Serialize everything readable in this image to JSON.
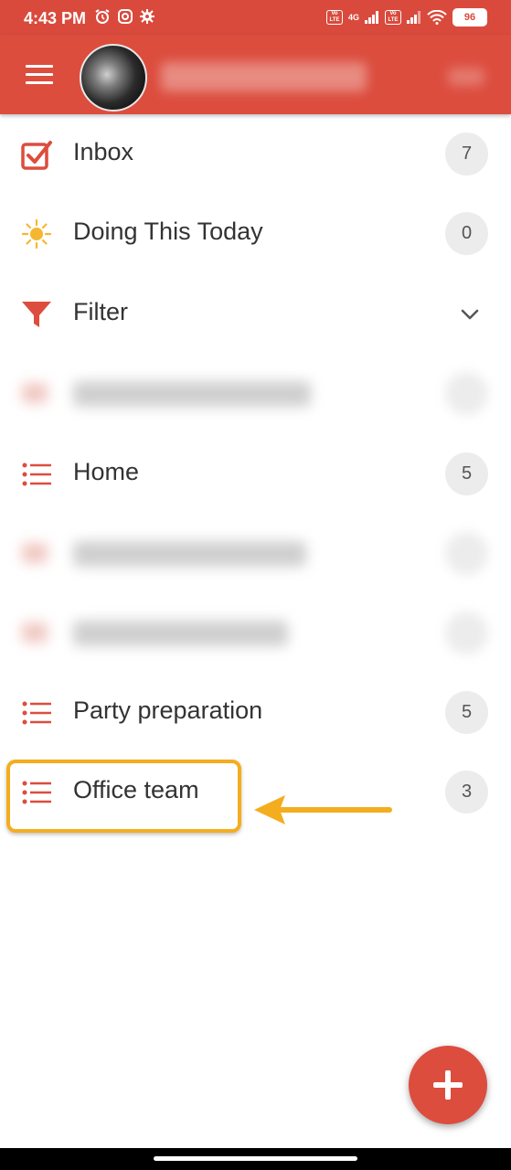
{
  "status_bar": {
    "time": "4:43 PM",
    "battery": "96",
    "network": "4G",
    "volte": "Vo LTE"
  },
  "app_bar": {
    "menu_icon": "hamburger-icon",
    "avatar": "avatar"
  },
  "nav_items": [
    {
      "label": "Inbox",
      "count": "7",
      "icon": "checkbox-icon"
    },
    {
      "label": "Doing This Today",
      "count": "0",
      "icon": "sun-icon"
    },
    {
      "label": "Filter",
      "icon": "filter-icon",
      "trailing": "chevron-down-icon"
    },
    {
      "label": "Home",
      "count": "5",
      "icon": "list-icon"
    },
    {
      "label": "Party preparation",
      "count": "5",
      "icon": "list-icon"
    },
    {
      "label": "Office team",
      "count": "3",
      "icon": "list-icon"
    }
  ],
  "fab": {
    "icon": "plus-icon"
  },
  "colors": {
    "primary": "#dc4d3e",
    "highlight": "#f4ad1f",
    "badge_bg": "#ececec",
    "sun": "#f5b731"
  }
}
